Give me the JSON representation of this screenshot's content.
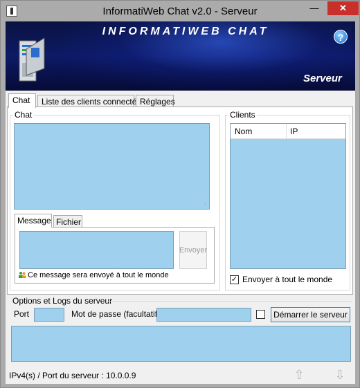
{
  "window": {
    "title": "InformatiWeb Chat v2.0 - Serveur",
    "min_label": "—",
    "max_label": "□",
    "close_label": "✕"
  },
  "banner": {
    "title": "INFORMATIWEB CHAT",
    "subtitle": "Serveur",
    "help_label": "?"
  },
  "tabs": [
    {
      "label": "Chat",
      "active": true
    },
    {
      "label": "Liste des clients connectés",
      "active": false
    },
    {
      "label": "Réglages",
      "active": false
    }
  ],
  "chat": {
    "group_label": "Chat",
    "message_tabs": [
      {
        "label": "Message",
        "active": true
      },
      {
        "label": "Fichier",
        "active": false
      }
    ],
    "send_label": "Envoyer",
    "broadcast_note": "Ce message sera envoyé à tout le monde"
  },
  "clients": {
    "group_label": "Clients",
    "columns": [
      "Nom",
      "IP"
    ],
    "broadcast_checkbox_label": "Envoyer à tout le monde",
    "broadcast_checked": true
  },
  "options": {
    "group_label": "Options et Logs du serveur",
    "port_label": "Port",
    "password_label": "Mot de passe (facultatif)",
    "password_checked": false,
    "start_label": "Démarrer le serveur"
  },
  "status": {
    "text": "IPv4(s) / Port du serveur : 10.0.0.9"
  },
  "colors": {
    "field_bg": "#9fd1ef",
    "banner_bg": "#0d1a66",
    "close_bg": "#c7302b"
  }
}
